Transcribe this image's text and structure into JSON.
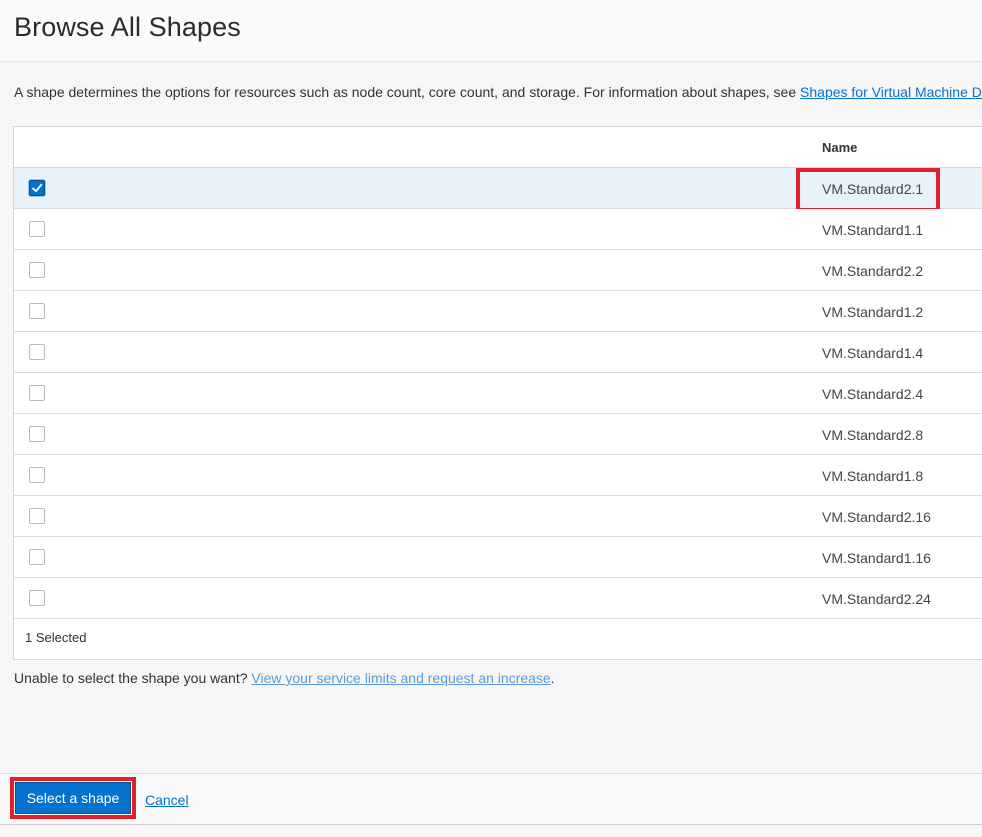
{
  "header": {
    "title": "Browse All Shapes"
  },
  "description": {
    "text": "A shape determines the options for resources such as node count, core count, and storage. For information about shapes, see ",
    "link_text": "Shapes for Virtual Machine D"
  },
  "table": {
    "columns": [
      "",
      "Name"
    ],
    "rows": [
      {
        "name": "VM.Standard2.1",
        "checked": true
      },
      {
        "name": "VM.Standard1.1",
        "checked": false
      },
      {
        "name": "VM.Standard2.2",
        "checked": false
      },
      {
        "name": "VM.Standard1.2",
        "checked": false
      },
      {
        "name": "VM.Standard1.4",
        "checked": false
      },
      {
        "name": "VM.Standard2.4",
        "checked": false
      },
      {
        "name": "VM.Standard2.8",
        "checked": false
      },
      {
        "name": "VM.Standard1.8",
        "checked": false
      },
      {
        "name": "VM.Standard2.16",
        "checked": false
      },
      {
        "name": "VM.Standard1.16",
        "checked": false
      },
      {
        "name": "VM.Standard2.24",
        "checked": false
      }
    ],
    "selected_count": "1 Selected"
  },
  "footnote": {
    "text": "Unable to select the shape you want? ",
    "link_text": "View your service limits and request an increase",
    "suffix": "."
  },
  "footer": {
    "select_label": "Select a shape",
    "cancel_label": "Cancel"
  },
  "colors": {
    "accent": "#0572ce",
    "highlight": "#e0202a",
    "selected_row": "#e8f2fb"
  },
  "icons": {
    "checkbox_checked": "check-icon"
  }
}
